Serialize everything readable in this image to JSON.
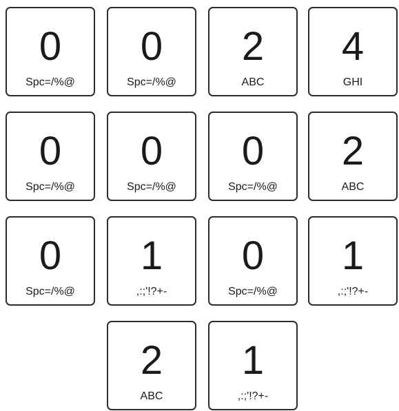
{
  "keys": [
    {
      "digit": "0",
      "letters": "Spc=/%@"
    },
    {
      "digit": "0",
      "letters": "Spc=/%@"
    },
    {
      "digit": "2",
      "letters": "ABC"
    },
    {
      "digit": "4",
      "letters": "GHI"
    },
    {
      "digit": "0",
      "letters": "Spc=/%@"
    },
    {
      "digit": "0",
      "letters": "Spc=/%@"
    },
    {
      "digit": "0",
      "letters": "Spc=/%@"
    },
    {
      "digit": "2",
      "letters": "ABC"
    },
    {
      "digit": "0",
      "letters": "Spc=/%@"
    },
    {
      "digit": "1",
      "letters": ",:;'!?+-"
    },
    {
      "digit": "0",
      "letters": "Spc=/%@"
    },
    {
      "digit": "1",
      "letters": ",:;'!?+-"
    },
    {
      "digit": "2",
      "letters": "ABC"
    },
    {
      "digit": "1",
      "letters": ",:;'!?+-"
    }
  ]
}
